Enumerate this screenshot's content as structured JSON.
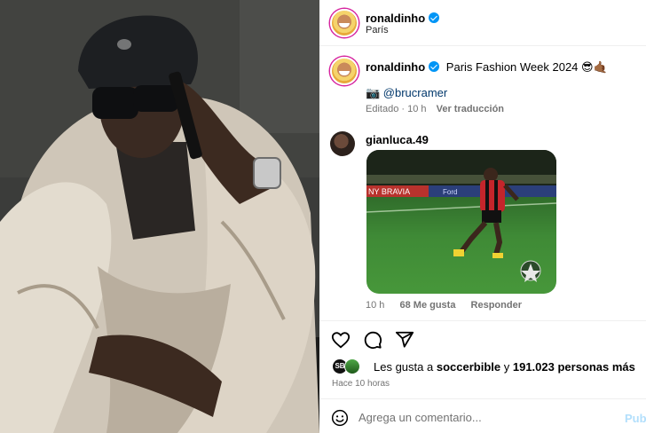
{
  "post": {
    "username": "ronaldinho",
    "location": "París",
    "caption": "Paris Fashion Week 2024 😎🤙🏾",
    "mention": "📷 @brucramer",
    "edited_label": "Editado",
    "edited_time": "10 h",
    "translate_label": "Ver traducción"
  },
  "comment": {
    "username": "gianluca.49",
    "time": "10 h",
    "likes_text": "68 Me gusta",
    "reply_label": "Responder",
    "gif_board_text": "NY BRAVIA",
    "gif_board_text2": "Ford"
  },
  "engagement": {
    "likes_prefix": "Les gusta a",
    "likes_user": "soccerbible",
    "likes_and": "y",
    "likes_count": "191.023 personas más",
    "liker_badge": "SB",
    "timestamp": "Hace 10 horas"
  },
  "composer": {
    "placeholder": "Agrega un comentario...",
    "publish_label": "Publicar"
  },
  "icons": {
    "verified": "verified-badge-icon",
    "like": "heart-icon",
    "comment": "comment-icon",
    "share": "send-icon",
    "emoji": "emoji-icon"
  },
  "colors": {
    "verified": "#0095f6",
    "link": "#00376b",
    "muted": "#737373",
    "publish_disabled": "#b2dffc"
  }
}
